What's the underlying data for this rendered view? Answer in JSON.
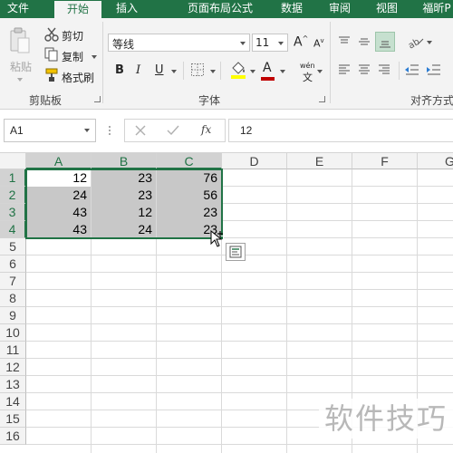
{
  "tabs": [
    "文件",
    "开始",
    "插入",
    "页面布局",
    "公式",
    "数据",
    "审阅",
    "视图",
    "福昕P"
  ],
  "active_tab": 1,
  "clipboard": {
    "paste_label": "粘贴",
    "cut_label": "剪切",
    "copy_label": "复制",
    "format_painter_label": "格式刷",
    "group_label": "剪贴板"
  },
  "font": {
    "name": "等线",
    "size": "11",
    "grow_label": "A",
    "shrink_label": "A",
    "bold": "B",
    "italic": "I",
    "underline": "U",
    "font_color_glyph": "A",
    "phonetic_top": "wén",
    "phonetic_bottom": "文",
    "group_label": "字体"
  },
  "alignment": {
    "group_label": "对齐方式"
  },
  "formula_bar": {
    "name_box": "A1",
    "fx_label": "fx",
    "value": "12"
  },
  "columns": [
    "A",
    "B",
    "C",
    "D",
    "E",
    "F",
    "G"
  ],
  "rows": [
    "1",
    "2",
    "3",
    "4",
    "5",
    "6",
    "7",
    "8",
    "9",
    "10",
    "11",
    "12",
    "13",
    "14",
    "15",
    "16"
  ],
  "cells": [
    [
      "12",
      "23",
      "76"
    ],
    [
      "24",
      "23",
      "56"
    ],
    [
      "43",
      "12",
      "23"
    ],
    [
      "43",
      "24",
      "23"
    ]
  ],
  "watermark": "软件技巧",
  "colors": {
    "accent": "#217346",
    "ribbon_bg": "#f3f3f3",
    "selection_fill": "#c8c8c8",
    "font_color_bar": "#c00000",
    "fill_color_bar": "#ffff00"
  },
  "icons": [
    "cut-icon",
    "copy-icon",
    "format-painter-icon",
    "paste-icon",
    "borders-icon",
    "fill-color-icon",
    "orientation-icon",
    "cancel-icon",
    "enter-icon",
    "quick-analysis-icon",
    "cursor-icon"
  ]
}
